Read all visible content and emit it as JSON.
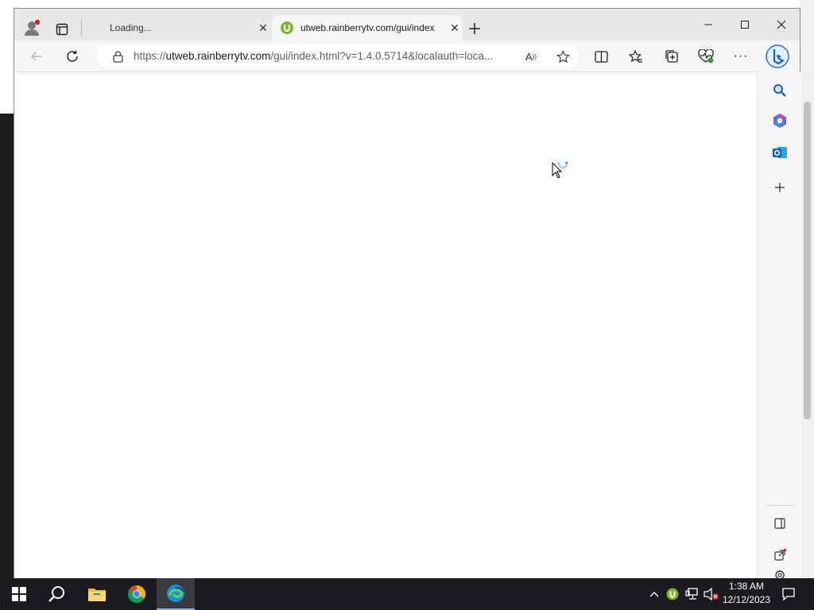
{
  "browser": {
    "tabs": [
      {
        "title": "Loading...",
        "active": false
      },
      {
        "title": "utweb.rainberrytv.com/gui/index",
        "active": true
      }
    ],
    "address_bar": {
      "scheme": "https://",
      "host": "utweb.rainberrytv.com",
      "path": "/gui/index.html?v=1.4.0.5714&localauth=loca..."
    },
    "icons": {
      "profile": "profile-avatar-icon",
      "workspaces": "tab-actions-icon",
      "new_tab": "plus-icon",
      "back": "back-arrow-icon",
      "refresh": "refresh-icon",
      "lock": "lock-icon",
      "read_aloud": "read-aloud-icon",
      "favorite": "star-icon",
      "split": "split-screen-icon",
      "favorites": "favorites-icon",
      "collections": "collections-icon",
      "health": "browser-essentials-icon",
      "more": "more-icon",
      "copilot": "bing-copilot-icon"
    },
    "sidebar_icons": [
      "search-icon",
      "office-icon",
      "outlook-icon",
      "add-icon",
      "sidebar-toggle-icon",
      "external-link-icon",
      "settings-icon"
    ]
  },
  "taskbar": {
    "apps": [
      "start-icon",
      "search-icon",
      "file-explorer-icon",
      "chrome-icon",
      "edge-icon"
    ],
    "clock": {
      "time": "1:38 AM",
      "date": "12/12/2023"
    }
  },
  "colors": {
    "edge_blue": "#0078d4",
    "utorrent_green": "#78b72a",
    "taskbar": "#1b1b1f",
    "notification_red": "#c42b1c"
  }
}
